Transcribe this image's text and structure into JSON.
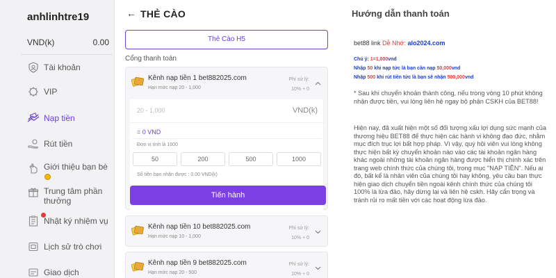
{
  "sidebar": {
    "username": "anhlinhtre19",
    "balance_label": "VND(k)",
    "balance_value": "0.00",
    "items": [
      {
        "label": "Tài khoản",
        "icon": "user-shield-icon"
      },
      {
        "label": "VIP",
        "icon": "vip-badge-icon"
      },
      {
        "label": "Nạp tiền",
        "icon": "deposit-icon",
        "active": true
      },
      {
        "label": "Rút tiền",
        "icon": "withdraw-icon"
      },
      {
        "label": "Giới thiệu bạn bè",
        "icon": "refer-friend-icon"
      },
      {
        "label": "Trung tâm phần thưởng",
        "icon": "gift-icon"
      },
      {
        "label": "Nhật ký nhiệm vụ",
        "icon": "task-log-icon"
      },
      {
        "label": "Lịch sử trò chơi",
        "icon": "game-history-icon"
      },
      {
        "label": "Giao dịch",
        "icon": "transaction-icon"
      }
    ]
  },
  "main": {
    "back_glyph": "←",
    "title": "THẺ CÀO",
    "tab_label": "Thẻ Cào H5",
    "gateway_label": "Cổng thanh toán",
    "channels": [
      {
        "name": "Kênh nạp tiền 1 bet882025.com",
        "limit": "Hạn mức nạp 20 - 1,000",
        "fee_label": "Phí sử lý:",
        "fee_value": "10% + 0",
        "expanded": true
      },
      {
        "name": "Kênh nạp tiền 10 bet882025.com",
        "limit": "Hạn mức nạp 10 - 1,000",
        "fee_label": "Phí sử lý:",
        "fee_value": "10% + 0",
        "expanded": false
      },
      {
        "name": "Kênh nạp tiền 9 bet882025.com",
        "limit": "Hạn mức nạp 20 - 500",
        "fee_label": "Phí sử lý:",
        "fee_value": "10% + 0",
        "expanded": false
      }
    ],
    "form": {
      "amount_placeholder": "20 - 1,000",
      "amount_unit": "VND(k)",
      "converted": "= 0 VND",
      "unit_note": "Đơn vị tính là 1000",
      "quick_amounts": [
        "50",
        "200",
        "500",
        "1000"
      ],
      "received": "Số tiền bạn nhận được : 0.00 VND(k)",
      "proceed_label": "Tiến hành"
    }
  },
  "guide": {
    "title": "Hướng dẫn thanh toán",
    "link_prefix": "bet88 link",
    "link_remember": "Dễ Nhớ:",
    "link_url": "alo2024.com",
    "rule1_a": "Chú ý:",
    "rule1_b": "1=1,000",
    "rule1_c": "vnd",
    "rule2_a": "Nhập",
    "rule2_b": "50",
    "rule2_c": "khi nạp tức là bạn cần nạp",
    "rule2_d": "50,000",
    "rule2_e": "vnd",
    "rule3_a": "Nhập",
    "rule3_b": "500",
    "rule3_c": "khi rút tiền tức là bạn sẽ nhận",
    "rule3_d": "500,000",
    "rule3_e": "vnd",
    "para1": "* Sau khi chuyển khoản thành công, nếu trong vòng 10 phút không nhận được tiền, vui lòng liên hệ ngay bộ phận CSKH của BET88!",
    "para2": "Hiện nay, đã xuất hiện một số đối tượng xấu lợi dụng sức mạnh của thương hiệu BET88 để thực hiện các hành vi không đạo đức, nhằm mục đích trục lợi bất hợp pháp. Vì vậy, quý hội viên vui lòng không thực hiện bất kỳ chuyển khoản nào vào các tài khoản ngân hàng khác ngoài những tài khoản ngân hàng được hiển thị chính xác trên trang web chính thức của chúng tôi, trong mục \"NẠP TIỀN\". Nếu ai đó, bất kể là nhân viên của chúng tôi hay không, yêu cầu bạn thực hiện giao dịch chuyển tiền ngoài kênh chính thức của chúng tôi 100% là lừa đảo, hãy dừng lại và liên hệ cskh. Hãy cẩn trọng và tránh rủi ro mất tiền với các hoạt động lừa đảo."
  },
  "colors": {
    "accent": "#7b3fe4",
    "link_blue": "#1a3dc7",
    "warning_red": "#e53935"
  }
}
